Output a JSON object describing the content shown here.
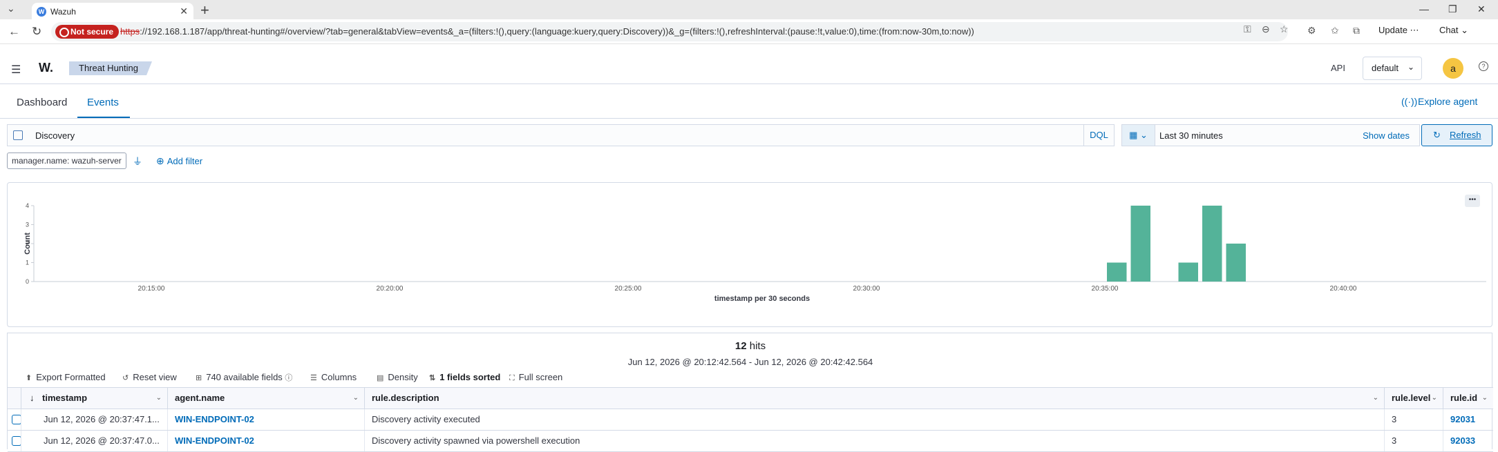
{
  "browser": {
    "tab_title": "Wazuh",
    "tab_favicon": "W",
    "not_secure_label": "Not secure",
    "url_scheme": "https",
    "url_rest": "://192.168.1.187/app/threat-hunting#/overview/?tab=general&tabView=events&_a=(filters:!(),query:(language:kuery,query:Discovery))&_g=(filters:!(),refreshInterval:(pause:!t,value:0),time:(from:now-30m,to:now))",
    "update_label": "Update",
    "chat_label": "Chat"
  },
  "header": {
    "logo": "W.",
    "breadcrumb": "Threat Hunting",
    "api_label": "API",
    "api_value": "default",
    "avatar_letter": "a"
  },
  "tabs": [
    {
      "label": "Dashboard",
      "active": false
    },
    {
      "label": "Events",
      "active": true
    }
  ],
  "explore_agent": "Explore agent",
  "query": {
    "text": "Discovery",
    "language": "DQL",
    "time_range": "Last 30 minutes",
    "show_dates": "Show dates",
    "refresh": "Refresh"
  },
  "filters": {
    "pill": "manager.name: wazuh-server",
    "add_filter": "Add filter"
  },
  "chart_data": {
    "type": "bar",
    "xlabel": "timestamp per 30 seconds",
    "ylabel": "Count",
    "ylim": [
      0,
      4
    ],
    "yticks": [
      0,
      1,
      2,
      3,
      4
    ],
    "xticks": [
      "20:15:00",
      "20:20:00",
      "20:25:00",
      "20:30:00",
      "20:35:00",
      "20:40:00"
    ],
    "x_start": "20:12:42",
    "x_end": "20:42:42",
    "bars": [
      {
        "x": "20:35:00",
        "value": 1
      },
      {
        "x": "20:35:30",
        "value": 4
      },
      {
        "x": "20:36:30",
        "value": 1
      },
      {
        "x": "20:37:00",
        "value": 4
      },
      {
        "x": "20:37:30",
        "value": 2
      }
    ],
    "color": "#54b399",
    "grid": false
  },
  "results": {
    "hits_count": "12",
    "hits_label": "hits",
    "range": "Jun 12, 2026 @ 20:12:42.564 - Jun 12, 2026 @ 20:42:42.564",
    "toolbar": {
      "export": "Export Formatted",
      "reset": "Reset view",
      "fields": "740 available fields",
      "columns": "Columns",
      "density": "Density",
      "sorted": "1 fields sorted",
      "fullscreen": "Full screen"
    },
    "columns": [
      "timestamp",
      "agent.name",
      "rule.description",
      "rule.level",
      "rule.id"
    ],
    "rows": [
      {
        "timestamp": "Jun 12, 2026 @ 20:37:47.1...",
        "agent": "WIN-ENDPOINT-02",
        "description": "Discovery activity executed",
        "level": "3",
        "id": "92031"
      },
      {
        "timestamp": "Jun 12, 2026 @ 20:37:47.0...",
        "agent": "WIN-ENDPOINT-02",
        "description": "Discovery activity spawned via powershell execution",
        "level": "3",
        "id": "92033"
      }
    ]
  }
}
